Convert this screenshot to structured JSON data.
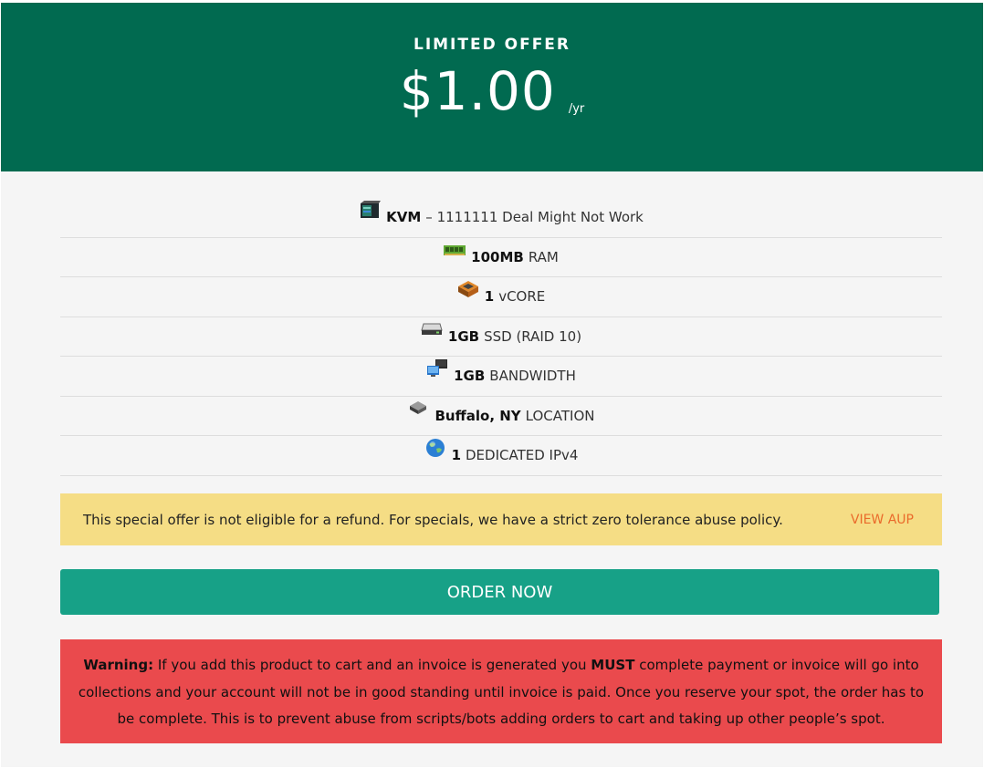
{
  "hero": {
    "title": "LIMITED OFFER",
    "price": "$1.00",
    "period": "/yr",
    "background_color": "#016a50"
  },
  "features": [
    {
      "icon": "kvm-server-icon",
      "strong": "KVM",
      "text": "– 1111111 Deal Might Not Work"
    },
    {
      "icon": "ram-module-icon",
      "strong": "100MB",
      "text": "RAM"
    },
    {
      "icon": "cpu-chip-icon",
      "strong": "1",
      "text": "vCORE"
    },
    {
      "icon": "hard-drive-icon",
      "strong": "1GB",
      "text": "SSD (RAID 10)"
    },
    {
      "icon": "network-computers-icon",
      "strong": "1GB",
      "text": "BANDWIDTH"
    },
    {
      "icon": "location-server-icon",
      "strong": "Buffalo, NY",
      "text": "LOCATION"
    },
    {
      "icon": "globe-icon",
      "strong": "1",
      "text": "DEDICATED IPv4"
    }
  ],
  "notice": {
    "text": "This special offer is not eligible for a refund. For specials, we have a strict zero tolerance abuse policy.",
    "link_label": "VIEW AUP",
    "background_color": "#f5dd85",
    "link_color": "#ea6a2b"
  },
  "order_button": {
    "label": "ORDER NOW",
    "color": "#17a187"
  },
  "warning": {
    "label": "Warning:",
    "text_before": "If you add this product to cart and an invoice is generated you",
    "emphasis": "MUST",
    "text_after": "complete payment or invoice will go into collections and your account will not be in good standing until invoice is paid. Once you reserve your spot, the order has to be complete. This is to prevent abuse from scripts/bots adding orders to cart and taking up other people’s spot.",
    "background_color": "#ea4a4d"
  }
}
